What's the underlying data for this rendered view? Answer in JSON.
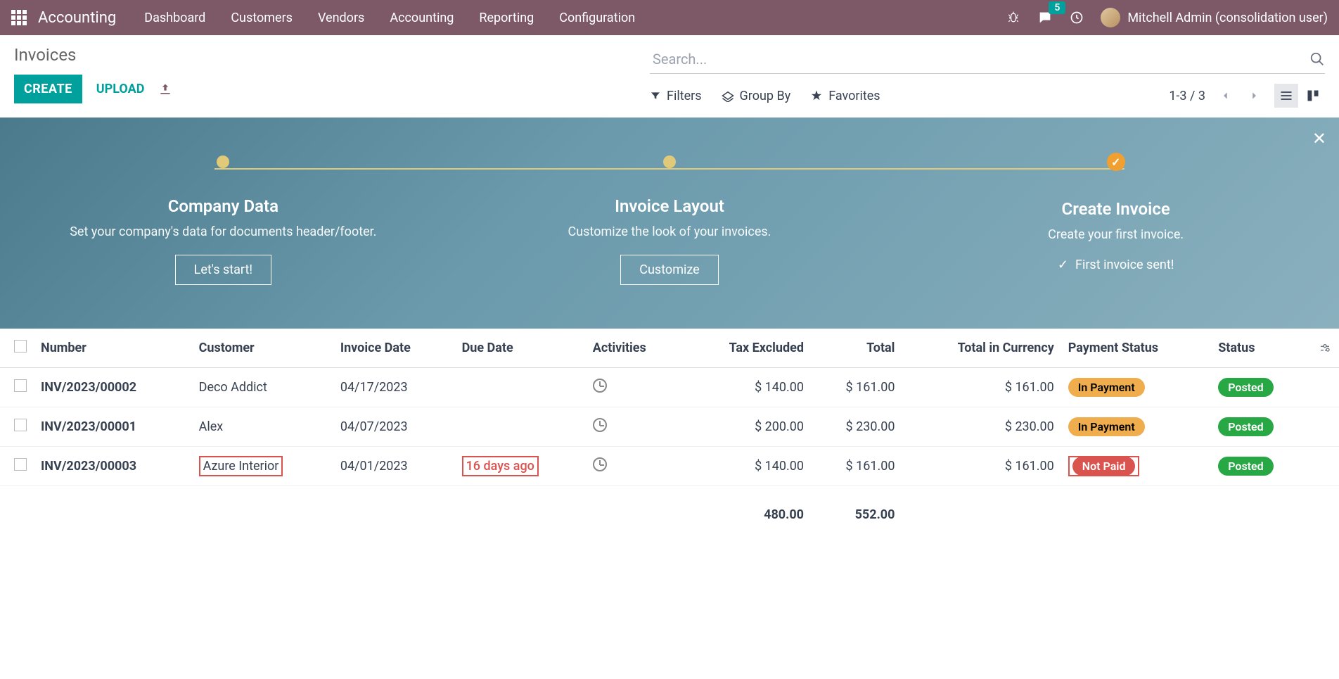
{
  "topnav": {
    "brand": "Accounting",
    "menu": [
      "Dashboard",
      "Customers",
      "Vendors",
      "Accounting",
      "Reporting",
      "Configuration"
    ],
    "msg_count": "5",
    "user": "Mitchell Admin (consolidation user)"
  },
  "cp": {
    "title": "Invoices",
    "create": "CREATE",
    "upload": "UPLOAD",
    "search_placeholder": "Search...",
    "filters": "Filters",
    "groupby": "Group By",
    "favorites": "Favorites",
    "pager": "1-3 / 3"
  },
  "onboard": {
    "steps": [
      {
        "title": "Company Data",
        "desc": "Set your company's data for documents header/footer.",
        "btn": "Let's start!"
      },
      {
        "title": "Invoice Layout",
        "desc": "Customize the look of your invoices.",
        "btn": "Customize"
      },
      {
        "title": "Create Invoice",
        "desc": "Create your first invoice.",
        "done": "First invoice sent!"
      }
    ]
  },
  "table": {
    "headers": {
      "number": "Number",
      "customer": "Customer",
      "invoice_date": "Invoice Date",
      "due_date": "Due Date",
      "activities": "Activities",
      "tax_excluded": "Tax Excluded",
      "total": "Total",
      "total_currency": "Total in Currency",
      "payment_status": "Payment Status",
      "status": "Status"
    },
    "rows": [
      {
        "number": "INV/2023/00002",
        "customer": "Deco Addict",
        "invoice_date": "04/17/2023",
        "due_date": "",
        "tax_excluded": "$ 140.00",
        "total": "$ 161.00",
        "total_currency": "$ 161.00",
        "payment_status": "In Payment",
        "payment_class": "badge-warning",
        "status": "Posted",
        "highlight": false,
        "overdue": false
      },
      {
        "number": "INV/2023/00001",
        "customer": "Alex",
        "invoice_date": "04/07/2023",
        "due_date": "",
        "tax_excluded": "$ 200.00",
        "total": "$ 230.00",
        "total_currency": "$ 230.00",
        "payment_status": "In Payment",
        "payment_class": "badge-warning",
        "status": "Posted",
        "highlight": false,
        "overdue": false
      },
      {
        "number": "INV/2023/00003",
        "customer": "Azure Interior",
        "invoice_date": "04/01/2023",
        "due_date": "16 days ago",
        "tax_excluded": "$ 140.00",
        "total": "$ 161.00",
        "total_currency": "$ 161.00",
        "payment_status": "Not Paid",
        "payment_class": "badge-danger",
        "status": "Posted",
        "highlight": true,
        "overdue": true
      }
    ],
    "totals": {
      "tax_excluded": "480.00",
      "total": "552.00"
    }
  }
}
